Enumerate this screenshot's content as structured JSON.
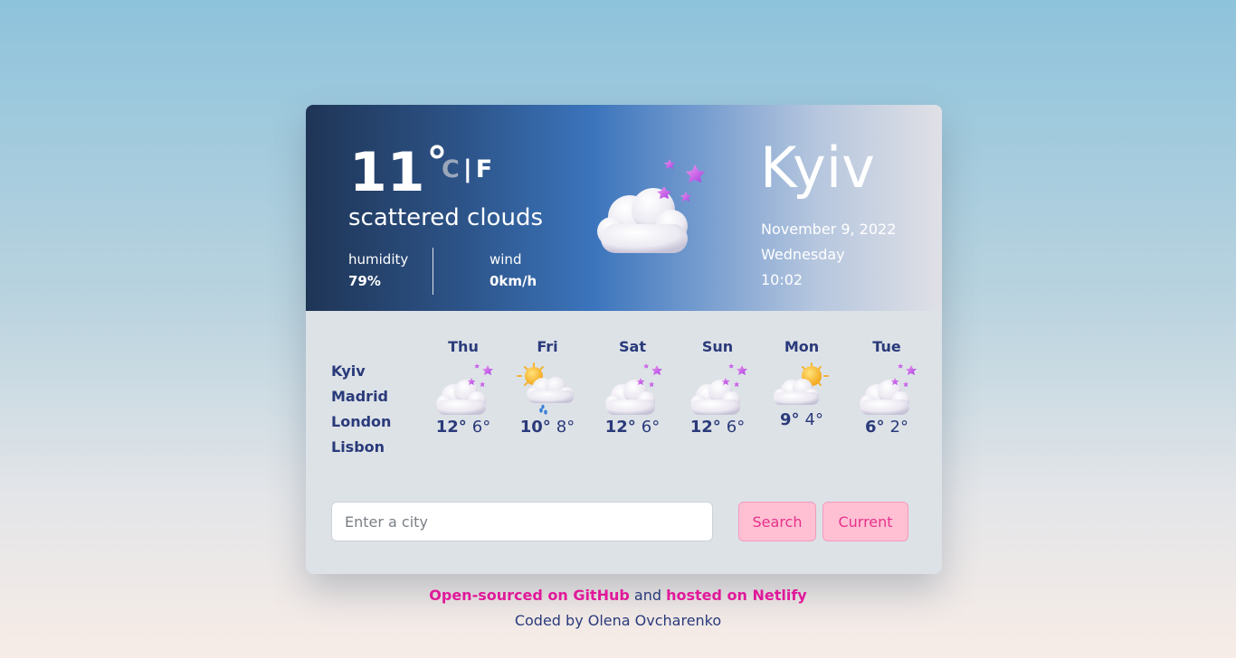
{
  "current": {
    "temperature": "11",
    "unit_c": "C",
    "unit_sep": "|",
    "unit_f": "F",
    "description": "scattered clouds",
    "humidity_label": "humidity",
    "humidity_value": "79%",
    "wind_label": "wind",
    "wind_value": "0km/h",
    "icon": "cloud-with-stars-icon",
    "city": "Kyiv",
    "date": "November 9, 2022",
    "weekday": "Wednesday",
    "time": "10:02"
  },
  "cities": [
    "Kyiv",
    "Madrid",
    "London",
    "Lisbon"
  ],
  "forecast": [
    {
      "day": "Thu",
      "icon": "cloud-with-stars-icon",
      "max": "12°",
      "min": "6°"
    },
    {
      "day": "Fri",
      "icon": "sun-cloud-rain-icon",
      "max": "10°",
      "min": "8°"
    },
    {
      "day": "Sat",
      "icon": "cloud-with-stars-icon",
      "max": "12°",
      "min": "6°"
    },
    {
      "day": "Sun",
      "icon": "cloud-with-stars-icon",
      "max": "12°",
      "min": "6°"
    },
    {
      "day": "Mon",
      "icon": "sun-behind-cloud-icon",
      "max": "9°",
      "min": "4°"
    },
    {
      "day": "Tue",
      "icon": "cloud-with-stars-icon",
      "max": "6°",
      "min": "2°"
    }
  ],
  "search": {
    "placeholder": "Enter a city",
    "value": "",
    "search_label": "Search",
    "current_label": "Current"
  },
  "footer": {
    "github_link": "Open-sourced on GitHub",
    "and": " and ",
    "netlify_link": "hosted on Netlify",
    "credit": "Coded by Olena Ovcharenko"
  },
  "colors": {
    "accent_pink": "#e0199a",
    "button_bg": "#ffc0d4",
    "text_navy": "#2a3a7a"
  }
}
